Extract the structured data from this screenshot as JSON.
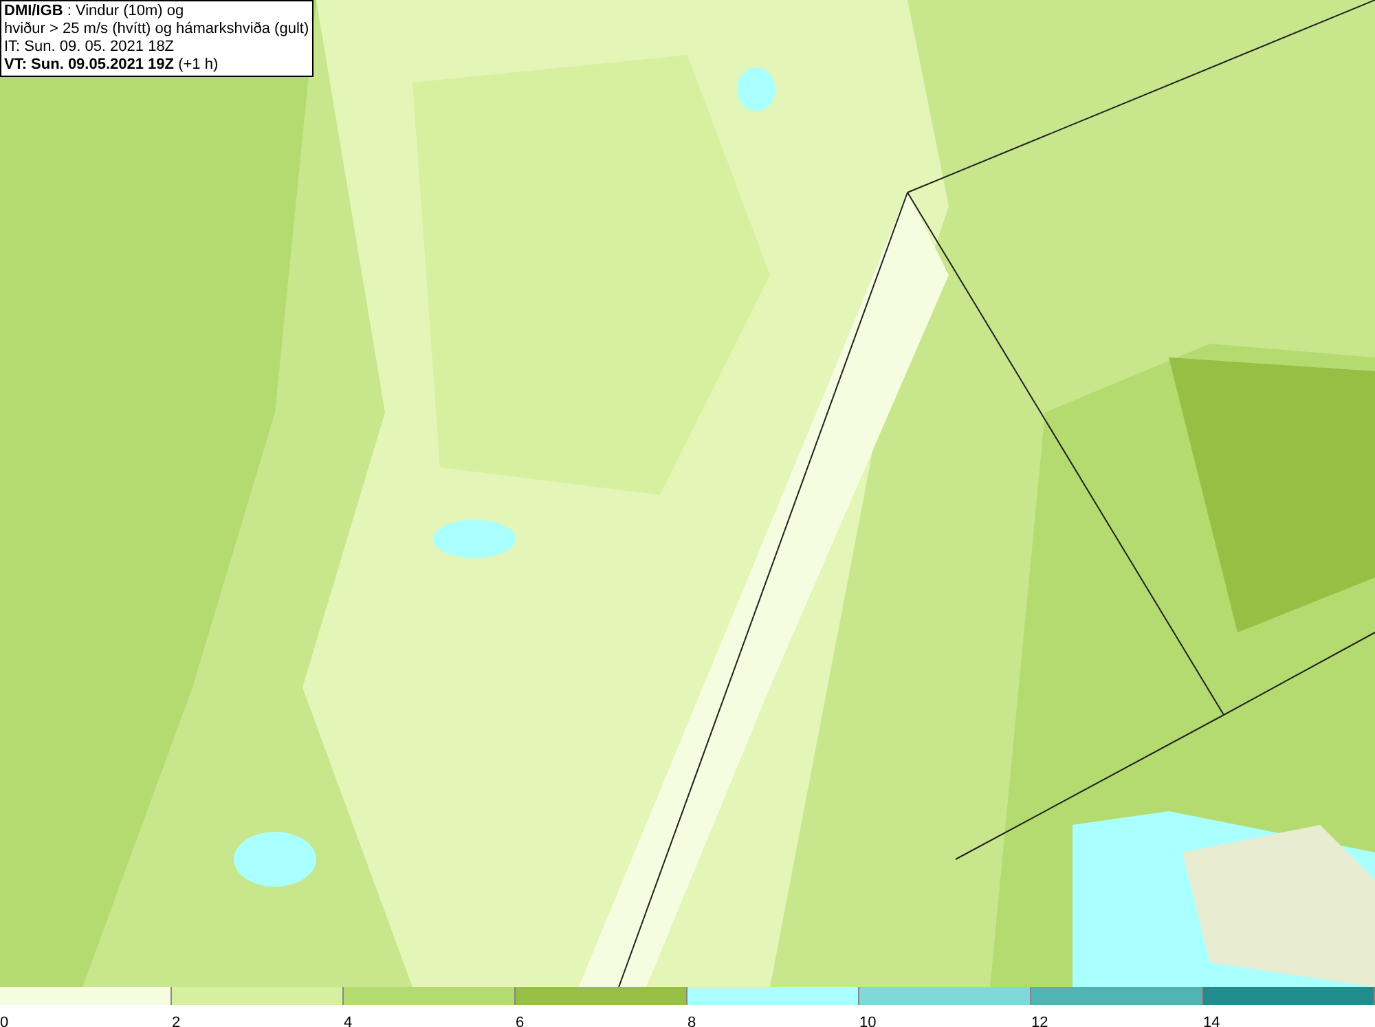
{
  "title_box": {
    "lines": [
      "**DMI/IGB** : Vindur (10m) og",
      "hviður > 25 m/s (hvítt) og hámarkshviða (gult)",
      "IT: Sun. 09. 05. 2021 18Z",
      "**VT: Sun. 09.05.2021 19Z** (+1 h)"
    ]
  },
  "legend": [
    {
      "label": "0",
      "color": "#f5fce0"
    },
    {
      "label": "2",
      "color": "#d6f0a0"
    },
    {
      "label": "4",
      "color": "#b4db70"
    },
    {
      "label": "6",
      "color": "#96bf44"
    },
    {
      "label": "8",
      "color": "#aaffff"
    },
    {
      "label": "10",
      "color": "#80d8d8"
    },
    {
      "label": "12",
      "color": "#50b4b4"
    },
    {
      "label": "14",
      "color": "#208c8c"
    }
  ]
}
